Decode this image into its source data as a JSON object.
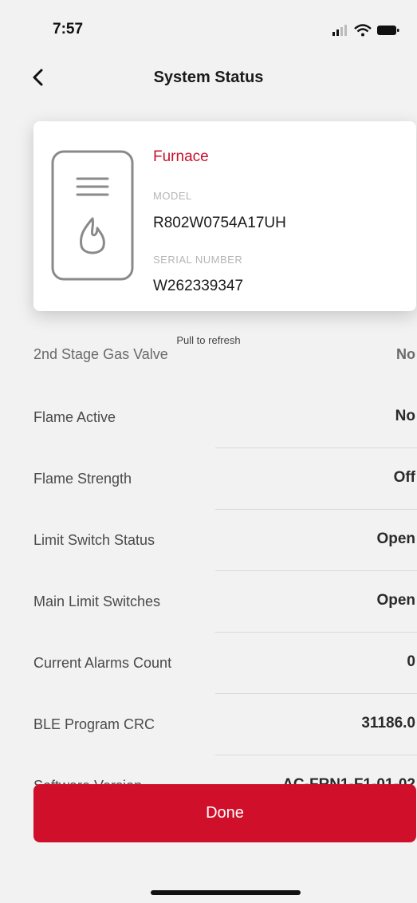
{
  "status_bar": {
    "time": "7:57",
    "icons": [
      "signal-icon",
      "wifi-icon",
      "battery-icon"
    ]
  },
  "nav": {
    "title": "System Status",
    "back_icon": "chevron-left-icon"
  },
  "device": {
    "icon": "furnace-flame-icon",
    "name": "Furnace",
    "model_label": "MODEL",
    "model_value": "R802W0754A17UH",
    "serial_label": "SERIAL NUMBER",
    "serial_value": "W262339347"
  },
  "pull_to_refresh": "Pull to refresh",
  "partial_row": {
    "label": "2nd Stage Gas Valve",
    "value": "No"
  },
  "rows": [
    {
      "label": "Flame Active",
      "value": "No"
    },
    {
      "label": "Flame Strength",
      "value": "Off"
    },
    {
      "label": "Limit Switch Status",
      "value": "Open"
    },
    {
      "label": "Main Limit Switches",
      "value": "Open"
    },
    {
      "label": "Current Alarms Count",
      "value": "0"
    },
    {
      "label": "BLE Program CRC",
      "value": "31186.0"
    },
    {
      "label": "Software Version",
      "value": "AC-FRN1-F1-01-02"
    }
  ],
  "done_button": {
    "label": "Done"
  },
  "colors": {
    "accent": "#d0102b",
    "device_name": "#c8102e",
    "background": "#f2f2f2"
  }
}
